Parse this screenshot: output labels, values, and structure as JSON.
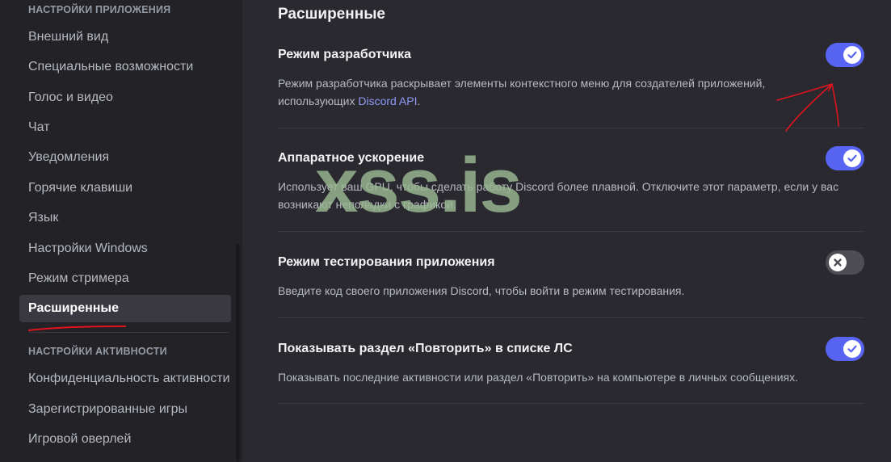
{
  "sidebar": {
    "section_app": "Настройки приложения",
    "items_app": [
      {
        "label": "Внешний вид"
      },
      {
        "label": "Специальные возможности"
      },
      {
        "label": "Голос и видео"
      },
      {
        "label": "Чат"
      },
      {
        "label": "Уведомления"
      },
      {
        "label": "Горячие клавиши"
      },
      {
        "label": "Язык"
      },
      {
        "label": "Настройки Windows"
      },
      {
        "label": "Режим стримера"
      },
      {
        "label": "Расширенные"
      }
    ],
    "section_activity": "Настройки активности",
    "items_activity": [
      {
        "label": "Конфиденциальность активности"
      },
      {
        "label": "Зарегистрированные игры"
      },
      {
        "label": "Игровой оверлей"
      }
    ]
  },
  "main": {
    "title": "Расширенные",
    "settings": [
      {
        "title": "Режим разработчика",
        "desc_before": "Режим разработчика раскрывает элементы контекстного меню для создателей приложений, использующих ",
        "desc_link": "Discord API",
        "desc_after": ".",
        "enabled": true
      },
      {
        "title": "Аппаратное ускорение",
        "desc": "Использует ваш GPU, чтобы сделать работу Discord более плавной. Отключите этот параметр, если у вас возникают неполадки с графикой.",
        "enabled": true
      },
      {
        "title": "Режим тестирования приложения",
        "desc": "Введите код своего приложения Discord, чтобы войти в режим тестирования.",
        "enabled": false
      },
      {
        "title": "Показывать раздел «Повторить» в списке ЛС",
        "desc": "Показывать последние активности или раздел «Повторить» на компьютере в личных сообщениях.",
        "enabled": true
      }
    ]
  },
  "watermark": "xss.is",
  "colors": {
    "toggle_on": "#5865f2",
    "toggle_off": "#4e4d54",
    "link": "#8f9bf7",
    "annotation": "#e0141e"
  },
  "icons": {
    "toggle_on": "check-icon",
    "toggle_off": "x-icon"
  }
}
